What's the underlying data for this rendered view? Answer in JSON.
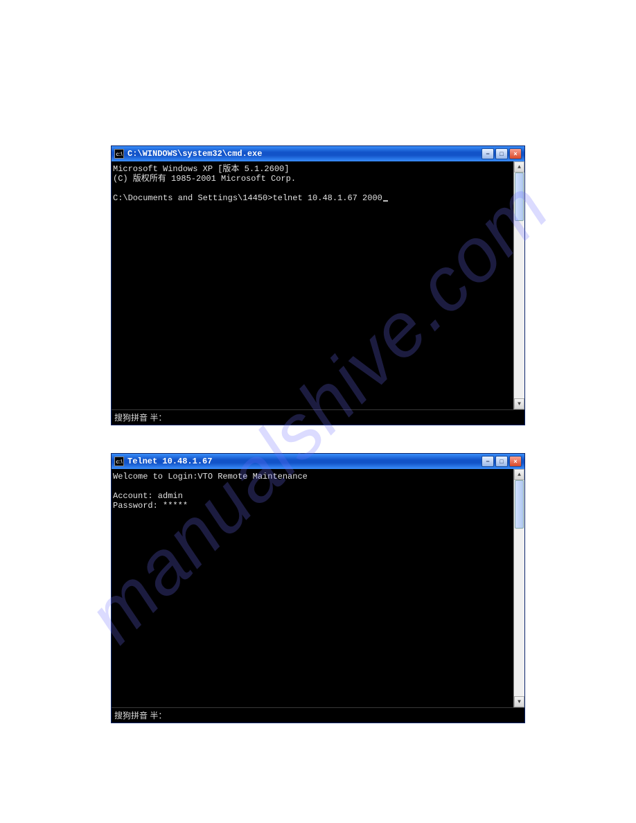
{
  "watermark": "manualshive.com",
  "window1": {
    "icon_glyph": "c:\\",
    "title": "C:\\WINDOWS\\system32\\cmd.exe",
    "buttons": {
      "min": "−",
      "max": "□",
      "close": "×"
    },
    "lines": {
      "l1": "Microsoft Windows XP [版本 5.1.2600]",
      "l2": "(C) 版权所有 1985-2001 Microsoft Corp.",
      "l3": "",
      "l4": "C:\\Documents and Settings\\14450>telnet 10.48.1.67 2000"
    },
    "ime": "搜狗拼音 半："
  },
  "window2": {
    "icon_glyph": "c:\\",
    "title": "Telnet 10.48.1.67",
    "buttons": {
      "min": "−",
      "max": "□",
      "close": "×"
    },
    "lines": {
      "l1": "Welcome to Login:VTO Remote Maintenance",
      "l2": "",
      "l3": "Account: admin",
      "l4": "Password: *****"
    },
    "ime": "搜狗拼音 半："
  }
}
